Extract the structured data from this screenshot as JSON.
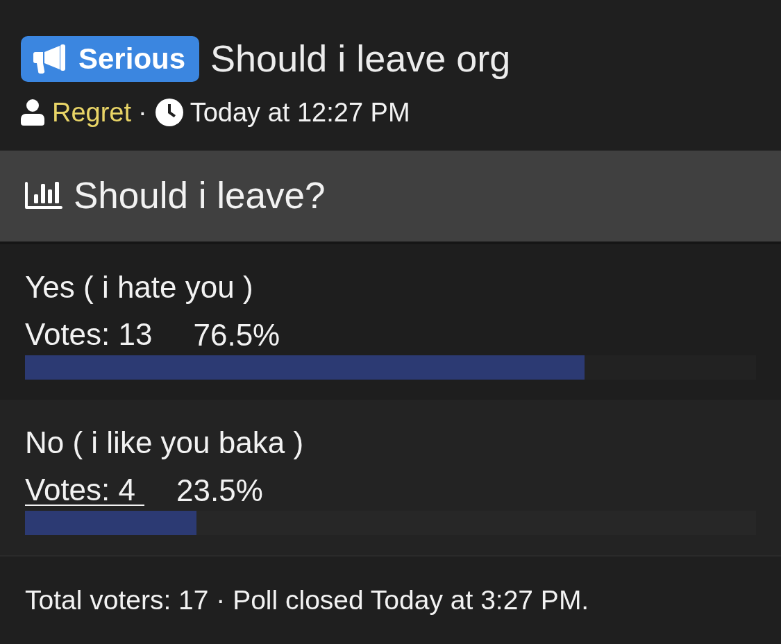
{
  "thread": {
    "prefix": "Serious",
    "title": "Should i leave org",
    "author": "Regret",
    "separator": "·",
    "date": "Today at 12:27 PM"
  },
  "poll": {
    "title": "Should i leave?",
    "options": [
      {
        "label": "Yes ( i hate you )",
        "votes": "Votes: 13",
        "percent": "76.5%",
        "level": 0.765,
        "hovered": false
      },
      {
        "label": "No ( i like you baka )",
        "votes": "Votes: 4",
        "percent": "23.5%",
        "level": 0.235,
        "hovered": true
      }
    ],
    "footer": "Total voters: 17 · Poll closed Today at 3:27 PM."
  }
}
